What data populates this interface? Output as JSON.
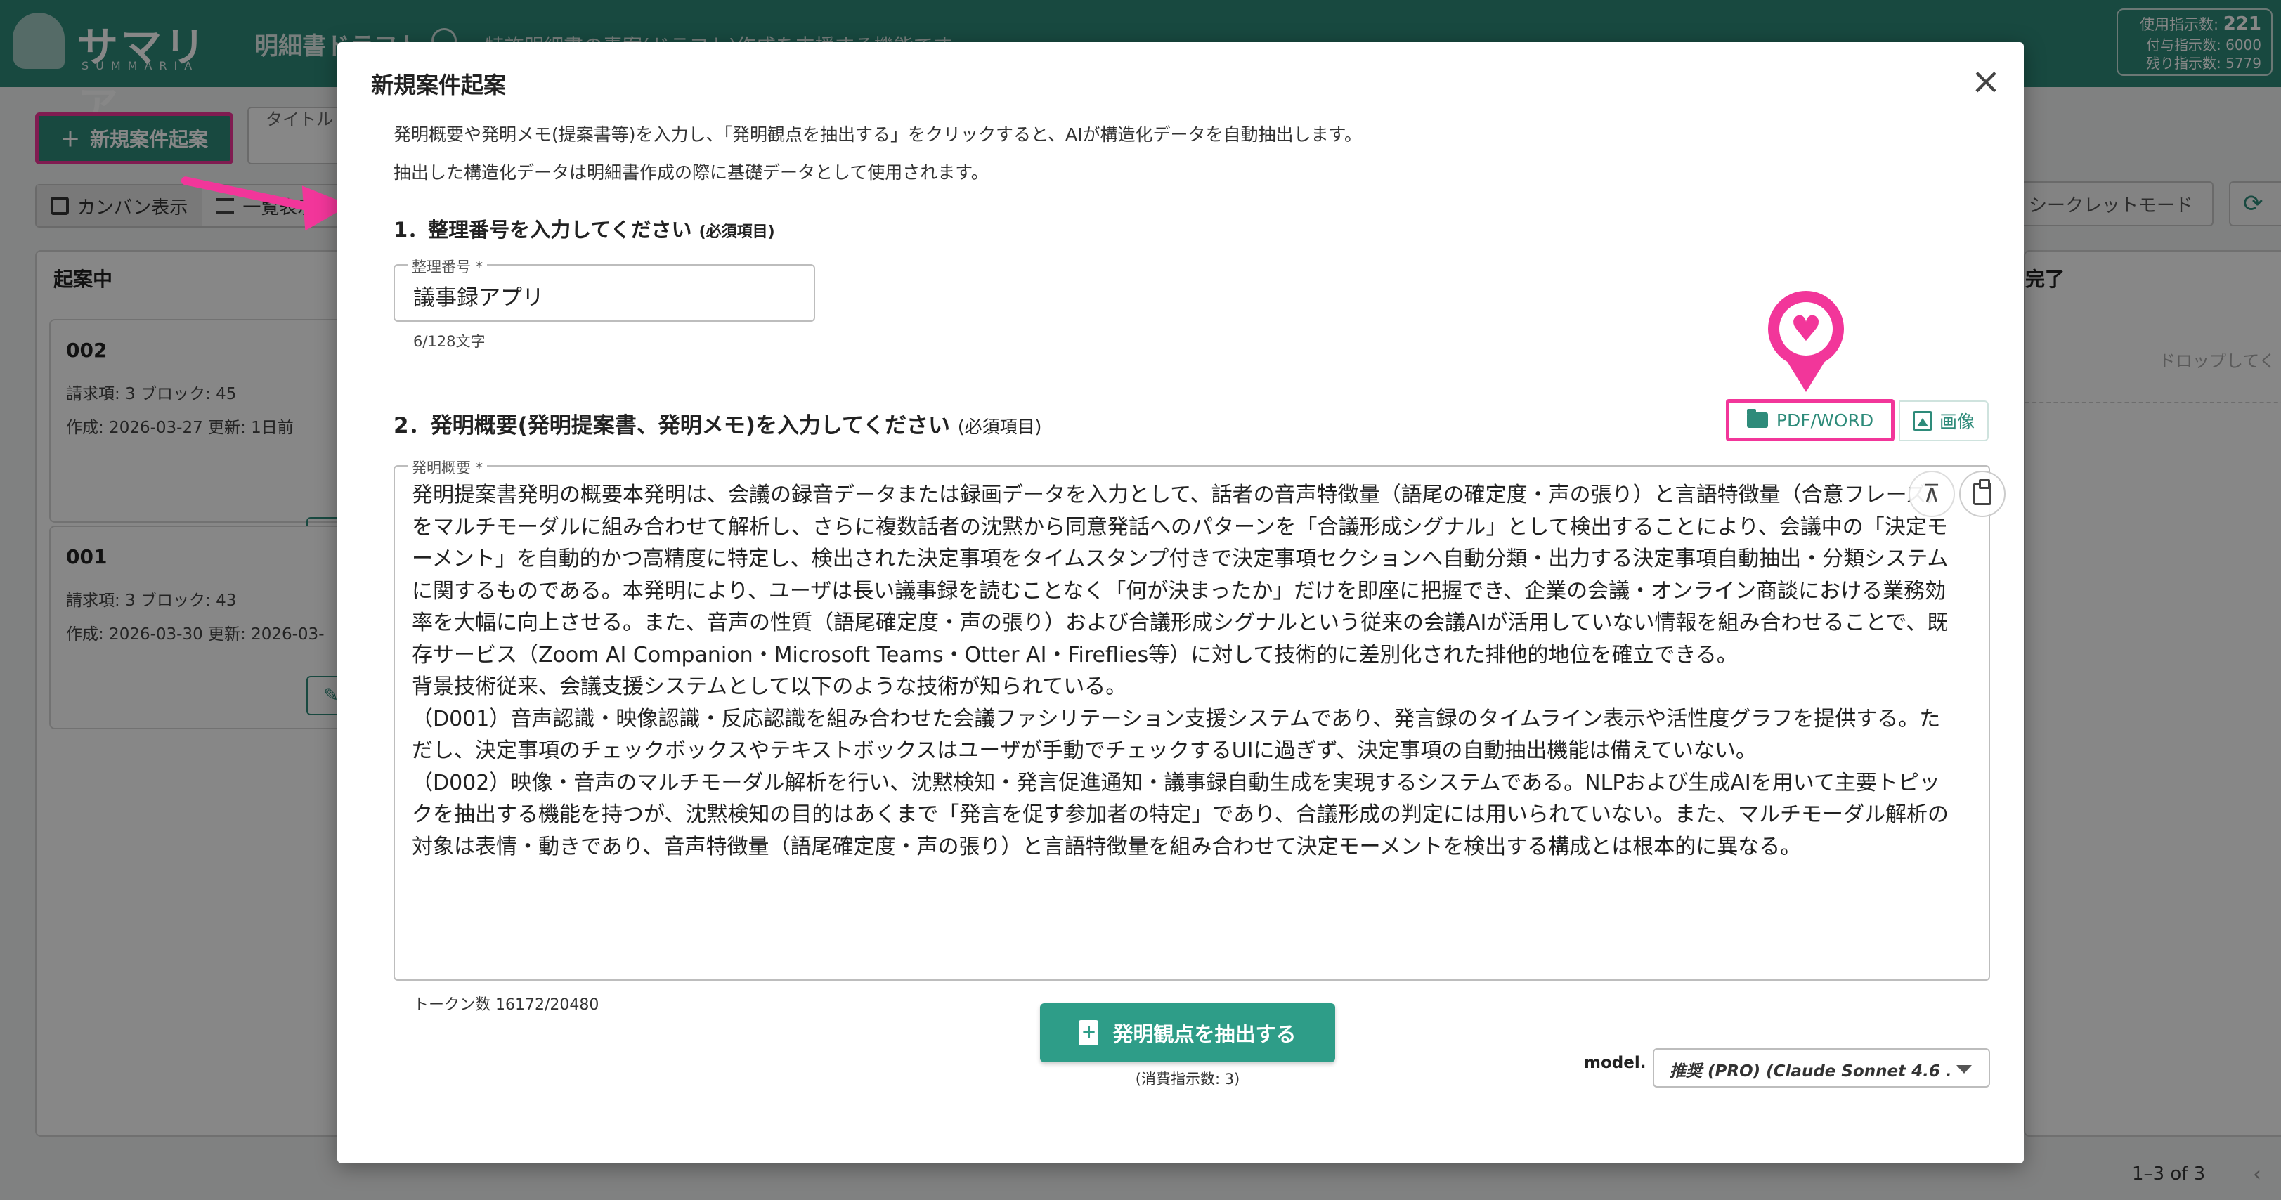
{
  "header": {
    "logo_jp": "サマリア",
    "logo_en": "SUMMARIA",
    "app_title": "明細書ドラフト",
    "app_subtitle": "特許明細書の素案(ドラフト)作成を支援する機能です",
    "usage": {
      "used_label": "使用指示数:",
      "used_value": "221",
      "granted_label": "付与指示数:",
      "granted_value": "6000",
      "remaining_label": "残り指示数:",
      "remaining_value": "5779"
    }
  },
  "toolbar": {
    "new_case_label": "新規案件起案",
    "title_placeholder": "タイトル",
    "kanban_view_label": "カンバン表示",
    "list_view_label": "一覧表示",
    "secret_mode_label": "シークレットモード",
    "refresh_label": "更"
  },
  "board": {
    "col_drafting": "起案中",
    "col_done": "完了",
    "drop_hint": "ドロップしてく",
    "cards": [
      {
        "id": "002",
        "line1": "請求項: 3  ブロック: 45",
        "line2": "作成: 2026-03-27  更新: 1日前"
      },
      {
        "id": "001",
        "line1": "請求項: 3  ブロック: 43",
        "line2": "作成: 2026-03-30  更新: 2026-03-"
      }
    ],
    "pagination": "1–3 of 3"
  },
  "modal": {
    "title": "新規案件起案",
    "desc1": "発明概要や発明メモ(提案書等)を入力し、「発明観点を抽出する」をクリックすると、AIが構造化データを自動抽出します。",
    "desc2": "抽出した構造化データは明細書作成の際に基礎データとして使用されます。",
    "section1_title": "1．整理番号を入力してください",
    "section1_note": "(必須項目)",
    "number_field": {
      "label": "整理番号 *",
      "value": "議事録アプリ",
      "counter": "6/128文字"
    },
    "section2_title": "2．発明概要(発明提案書、発明メモ)を入力してください",
    "section2_note": "(必須項目)",
    "pdf_word_label": "PDF/WORD",
    "image_label": "画像",
    "summary_field": {
      "label": "発明概要 *",
      "value": "発明提案書発明の概要本発明は、会議の録音データまたは録画データを入力として、話者の音声特徴量（語尾の確定度・声の張り）と言語特徴量（合意フレーズ）をマルチモーダルに組み合わせて解析し、さらに複数話者の沈黙から同意発話へのパターンを「合議形成シグナル」として検出することにより、会議中の「決定モーメント」を自動的かつ高精度に特定し、検出された決定事項をタイムスタンプ付きで決定事項セクションへ自動分類・出力する決定事項自動抽出・分類システムに関するものである。本発明により、ユーザは長い議事録を読むことなく「何が決まったか」だけを即座に把握でき、企業の会議・オンライン商談における業務効率を大幅に向上させる。また、音声の性質（語尾確定度・声の張り）および合議形成シグナルという従来の会議AIが活用していない情報を組み合わせることで、既存サービス（Zoom AI Companion・Microsoft Teams・Otter AI・Fireflies等）に対して技術的に差別化された排他的地位を確立できる。\n背景技術従来、会議支援システムとして以下のような技術が知られている。\n（D001）音声認識・映像認識・反応認識を組み合わせた会議ファシリテーション支援システムであり、発言録のタイムライン表示や活性度グラフを提供する。ただし、決定事項のチェックボックスやテキストボックスはユーザが手動でチェックするUIに過ぎず、決定事項の自動抽出機能は備えていない。\n（D002）映像・音声のマルチモーダル解析を行い、沈黙検知・発言促進通知・議事録自動生成を実現するシステムである。NLPおよび生成AIを用いて主要トピックを抽出する機能を持つが、沈黙検知の目的はあくまで「発言を促す参加者の特定」であり、合議形成の判定には用いられていない。また、マルチモーダル解析の対象は表情・動きであり、音声特徴量（語尾確定度・声の張り）と言語特徴量を組み合わせて決定モーメントを検出する構成とは根本的に異なる。",
      "token_count": "トークン数 16172/20480"
    },
    "extract_button_label": "発明観点を抽出する",
    "consume_note": "(消費指示数: 3)",
    "model_label": "model.",
    "model_value": "推奨 (PRO) (Claude Sonnet 4.6 ...",
    "accent_color": "#2e8b7a",
    "highlight_color": "#f2369a"
  }
}
